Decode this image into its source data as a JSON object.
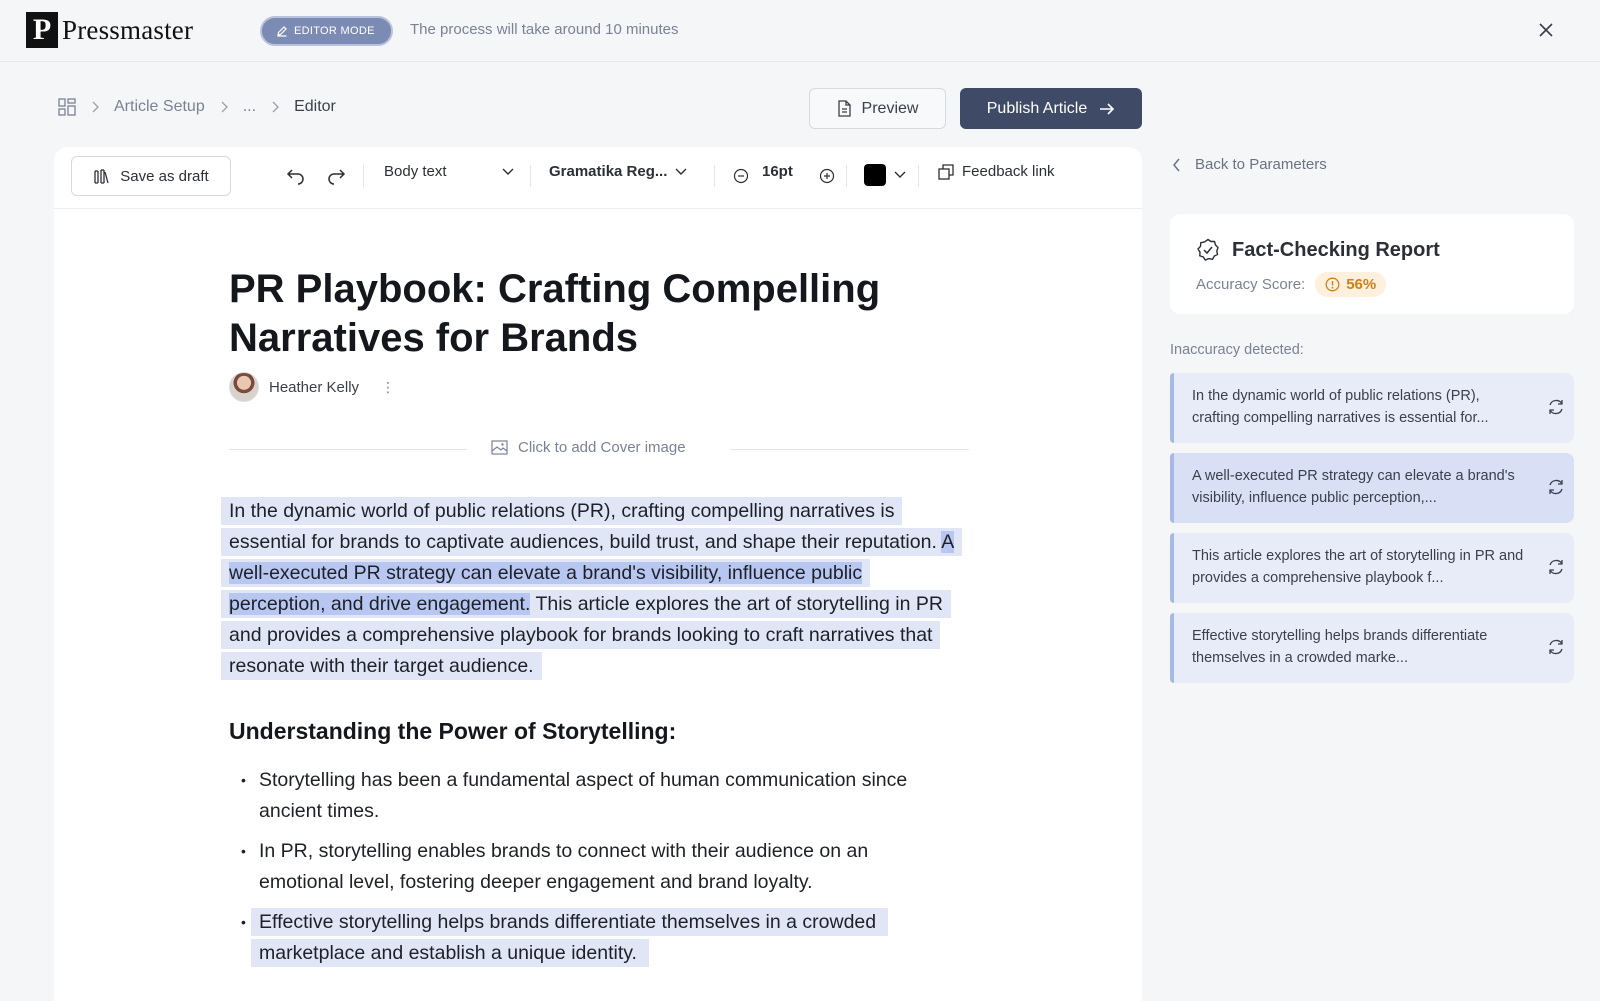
{
  "app": {
    "logo_letter": "P",
    "logo_text": "Pressmaster"
  },
  "topbar": {
    "mode_label": "EDITOR MODE",
    "process_text": "The process will take around 10 minutes"
  },
  "breadcrumb": {
    "items": [
      "Article Setup",
      "...",
      "Editor"
    ]
  },
  "actions": {
    "preview_label": "Preview",
    "publish_label": "Publish Article"
  },
  "toolbar": {
    "save_draft_label": "Save as draft",
    "text_style": "Body text",
    "font_name": "Gramatika Reg...",
    "font_size": "16pt",
    "color_value": "#000000",
    "feedback_label": "Feedback link"
  },
  "article": {
    "title": "PR Playbook: Crafting Compelling Narratives for Brands",
    "author": "Heather Kelly",
    "cover_label": "Click to add Cover image",
    "intro_part1": "In the dynamic world of public relations (PR), crafting compelling narratives is essential for brands to captivate audiences, build trust, and shape their reputation. ",
    "intro_part2": "A well-executed PR strategy can elevate a brand's visibility, influence public perception, and drive engagement.",
    "intro_part3": " This article explores the art of storytelling in PR and provides a comprehensive playbook for brands looking to craft narratives that resonate with their target audience.",
    "heading": "Understanding the Power of Storytelling:",
    "bullets": [
      "Storytelling has been a fundamental aspect of human communication since ancient times.",
      "In PR, storytelling enables brands to connect with their audience on an emotional level, fostering deeper engagement and brand loyalty.",
      "Effective storytelling helps brands differentiate themselves in a crowded marketplace and establish a unique identity."
    ]
  },
  "sidebar": {
    "back_label": "Back to Parameters",
    "report_title": "Fact-Checking Report",
    "score_label": "Accuracy Score:",
    "score_value": "56%",
    "inaccuracy_label": "Inaccuracy detected:",
    "items": [
      "In the dynamic world of public relations (PR), crafting compelling narratives is essential for...",
      "A well-executed PR strategy can elevate a brand's visibility, influence public perception,...",
      "This article explores the art of storytelling in PR and provides a comprehensive playbook f...",
      "Effective storytelling helps brands differentiate themselves in a crowded marke..."
    ]
  },
  "colors": {
    "accent": "#3e4a66",
    "highlight": "#e1e6f7",
    "highlight_strong": "#b8c6f2",
    "score": "#d0801a"
  }
}
